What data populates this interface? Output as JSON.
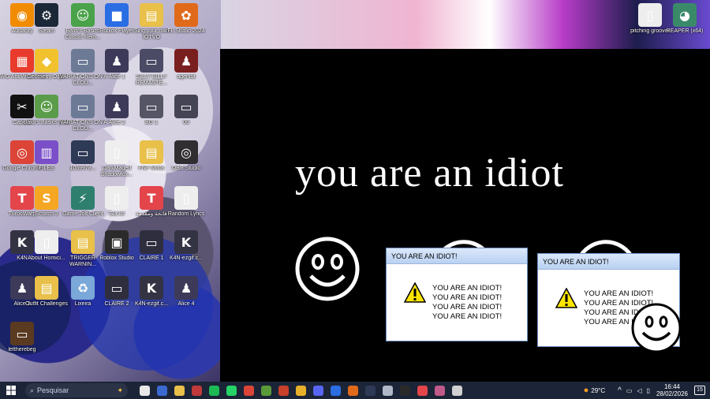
{
  "desktop": {
    "icons": [
      {
        "label": "Audacity",
        "color": "#f18b00",
        "glyph": "◉"
      },
      {
        "label": "Steam",
        "color": "#1b2838",
        "glyph": "⚙"
      },
      {
        "label": "Baldi's Basics Classic Rem...",
        "color": "#4aa34a",
        "glyph": "☺"
      },
      {
        "label": "Roblox Player",
        "color": "#2b6de3",
        "glyph": "■"
      },
      {
        "label": "Sing your own IOTVO",
        "color": "#e8c04a",
        "glyph": "▤"
      },
      {
        "label": "FL Studio 2024",
        "color": "#e06a1a",
        "glyph": "✿"
      },
      {
        "label": "AVG AntiVirus Free",
        "color": "#e83b2b",
        "glyph": "▦"
      },
      {
        "label": "Geometry Dash",
        "color": "#f1c22e",
        "glyph": "◆"
      },
      {
        "label": "[VARIATIONS ON A CLOU...",
        "color": "#6c7a95",
        "glyph": "▭"
      },
      {
        "label": "Alice 1",
        "color": "#3c3a58",
        "glyph": "♟"
      },
      {
        "label": "SILLY BILLY REMASTE...",
        "color": "#4b4b66",
        "glyph": "▭"
      },
      {
        "label": "agenda",
        "color": "#7a1f1f",
        "glyph": "♟"
      },
      {
        "label": "CapCut",
        "color": "#111111",
        "glyph": "✂"
      },
      {
        "label": "Baldi's Basics Plus",
        "color": "#5b9c4a",
        "glyph": "☺"
      },
      {
        "label": "[VARIATIONS ON A CLOU...",
        "color": "#6c7a95",
        "glyph": "▭"
      },
      {
        "label": "Alice 2",
        "color": "#3c3a58",
        "glyph": "♟"
      },
      {
        "label": "BG 1",
        "color": "#555566",
        "glyph": "▭"
      },
      {
        "label": "09",
        "color": "#444455",
        "glyph": "▭"
      },
      {
        "label": "Google Chrome",
        "color": "#db4437",
        "glyph": "◎"
      },
      {
        "label": "FILES",
        "color": "#7a4fc8",
        "glyph": "▥"
      },
      {
        "label": "1059978...",
        "color": "#2e3a56",
        "glyph": "▭"
      },
      {
        "label": "DarkMaged Shadowfox...",
        "color": "#eeeeee",
        "glyph": "▯"
      },
      {
        "label": "FNF Mods",
        "color": "#e8c04a",
        "glyph": "▤"
      },
      {
        "label": "OBS Studio",
        "color": "#302e31",
        "glyph": "◎"
      },
      {
        "label": "TurboWarp",
        "color": "#e3454b",
        "glyph": "T"
      },
      {
        "label": "Scratch 3",
        "color": "#f5a623",
        "glyph": "S"
      },
      {
        "label": "Game Jolt Client",
        "color": "#2f7f6f",
        "glyph": "⚡"
      },
      {
        "label": "Sla krl",
        "color": "#eeeeee",
        "glyph": "▯"
      },
      {
        "label": "فاتحة ومقدمة",
        "color": "#e3454b",
        "glyph": "T"
      },
      {
        "label": "Random Lyrics",
        "color": "#eeeeee",
        "glyph": "▯"
      },
      {
        "label": "K4N",
        "color": "#333344",
        "glyph": "K"
      },
      {
        "label": "About Homici...",
        "color": "#eeeeee",
        "glyph": "▯"
      },
      {
        "label": "TRIGGER WARNIN...",
        "color": "#e8c04a",
        "glyph": "▤"
      },
      {
        "label": "Roblox Studio",
        "color": "#2b2b2b",
        "glyph": "▣"
      },
      {
        "label": "CLAIRE 1",
        "color": "#2e2e3e",
        "glyph": "▭"
      },
      {
        "label": "K4N-ezgif.c...",
        "color": "#333344",
        "glyph": "K"
      },
      {
        "label": "Alice 3",
        "color": "#3c3a58",
        "glyph": "♟"
      },
      {
        "label": "Outfit Challenges",
        "color": "#e8c04a",
        "glyph": "▤"
      },
      {
        "label": "Lixeira",
        "color": "#7aa8d8",
        "glyph": "♻"
      },
      {
        "label": "CLAIRE 2",
        "color": "#2e2e3e",
        "glyph": "▭"
      },
      {
        "label": "K4N-ezgif.c...",
        "color": "#333344",
        "glyph": "K"
      },
      {
        "label": "Alice 4",
        "color": "#3c3a58",
        "glyph": "♟"
      },
      {
        "label": "lettherebeg",
        "color": "#5a3a20",
        "glyph": "▭"
      }
    ],
    "right_icons": [
      {
        "label": "pitching groover",
        "color": "#eeeeee",
        "glyph": "▯"
      },
      {
        "label": "REAPER (x64)",
        "color": "#3a8a6a",
        "glyph": "◕"
      }
    ]
  },
  "window": {
    "heading": "you are an idiot"
  },
  "dialogs": [
    {
      "title": "YOU ARE AN IDIOT!",
      "lines": [
        "YOU ARE AN IDIOT!",
        "YOU ARE AN IDIOT!",
        "YOU ARE AN IDIOT!",
        "YOU ARE AN IDIOT!"
      ]
    },
    {
      "title": "YOU ARE AN IDIOT!",
      "lines": [
        "YOU ARE AN IDIOT!",
        "YOU ARE AN IDIOT!",
        "YOU ARE AN IDIOT!",
        "YOU ARE AN IDIOT!"
      ]
    }
  ],
  "taskbar": {
    "search_placeholder": "Pesquisar",
    "apps": [
      "#e8e8e8",
      "#3a6ad0",
      "#e8c04a",
      "#c0393b",
      "#1db954",
      "#25d366",
      "#db4437",
      "#5a9a3a",
      "#c8402a",
      "#e8b02a",
      "#5865f2",
      "#2b6de3",
      "#e06a1a",
      "#2e3a56",
      "#b0b8c8",
      "#2a2a2a",
      "#e3454b",
      "#c05a8a",
      "#d0d0d0"
    ],
    "weather": "29°C",
    "time": "16:44",
    "date": "28/02/2026",
    "notifications": "15"
  }
}
